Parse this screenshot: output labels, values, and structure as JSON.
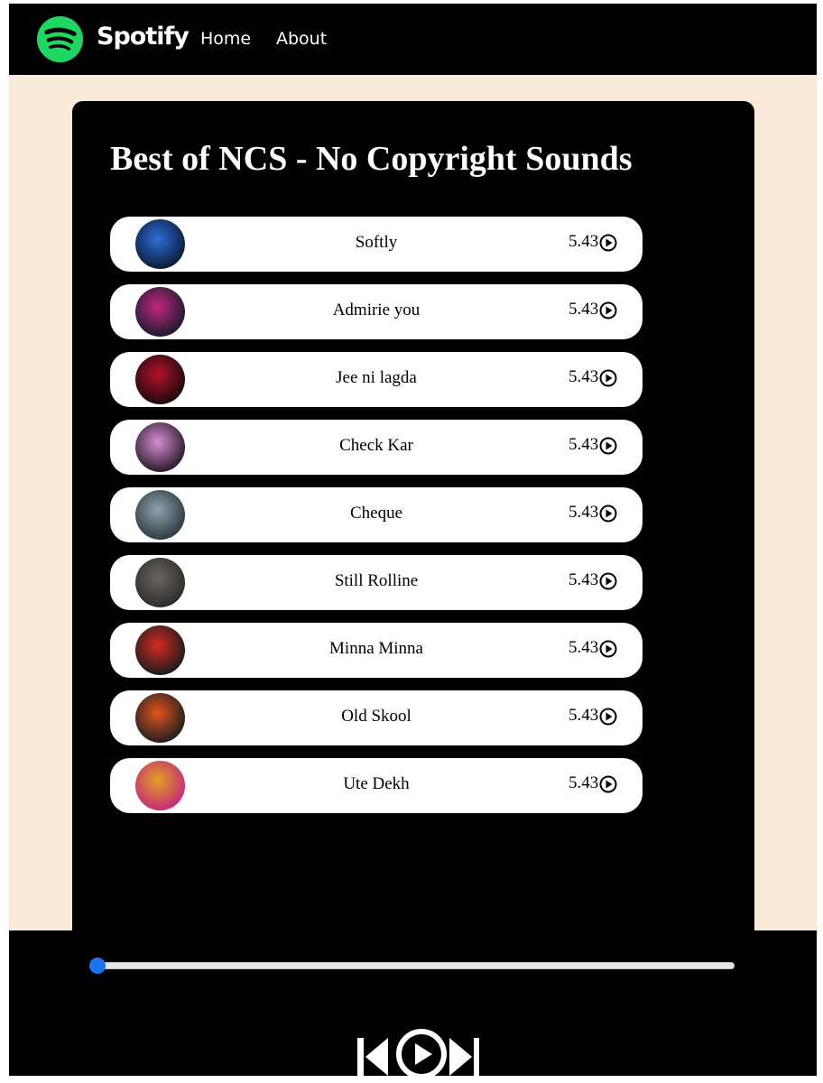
{
  "navbar": {
    "brand": "Spotify",
    "links": [
      {
        "label": "Home"
      },
      {
        "label": "About"
      }
    ],
    "icon": "spotify-logo-icon"
  },
  "playlist": {
    "title": "Best of NCS - No Copyright Sounds",
    "songs": [
      {
        "name": "Softly",
        "duration": "5.43",
        "cover_colors": [
          "#2b6fd6",
          "#0d1a3a"
        ]
      },
      {
        "name": "Admirie you",
        "duration": "5.43",
        "cover_colors": [
          "#c1287f",
          "#1a1a2e"
        ]
      },
      {
        "name": "Jee ni lagda",
        "duration": "5.43",
        "cover_colors": [
          "#b3122a",
          "#1a0a0a"
        ]
      },
      {
        "name": "Check Kar",
        "duration": "5.43",
        "cover_colors": [
          "#d48fd0",
          "#2a1a2a"
        ]
      },
      {
        "name": "Cheque",
        "duration": "5.43",
        "cover_colors": [
          "#8fa2ad",
          "#2d3a40"
        ]
      },
      {
        "name": "Still Rolline",
        "duration": "5.43",
        "cover_colors": [
          "#6a6560",
          "#2e2b29"
        ]
      },
      {
        "name": "Minna Minna",
        "duration": "5.43",
        "cover_colors": [
          "#d42a1f",
          "#1b1b1b"
        ]
      },
      {
        "name": "Old Skool",
        "duration": "5.43",
        "cover_colors": [
          "#e2541c",
          "#1f1f1f"
        ]
      },
      {
        "name": "Ute Dekh",
        "duration": "5.43",
        "cover_colors": [
          "#e0a021",
          "#c52a7a"
        ]
      }
    ]
  },
  "player": {
    "progress": 0,
    "icons": [
      "previous-icon",
      "play-icon",
      "next-icon"
    ]
  },
  "colors": {
    "accent": "#1ed760",
    "page_bg": "#f9ead9",
    "slider_thumb": "#1b74f4"
  }
}
